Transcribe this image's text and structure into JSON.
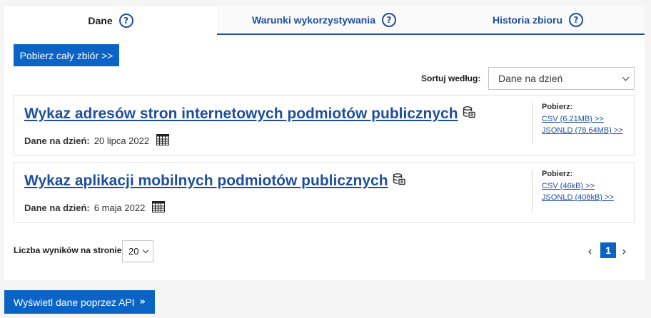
{
  "tabs": [
    {
      "label": "Dane",
      "help": "?"
    },
    {
      "label": "Warunki wykorzystywania",
      "help": "?"
    },
    {
      "label": "Historia zbioru",
      "help": "?"
    }
  ],
  "download_all_label": "Pobierz cały zbiór >>",
  "sort": {
    "label": "Sortuj według:",
    "value": "Dane na dzień"
  },
  "resources": [
    {
      "title": "Wykaz adresów stron internetowych podmiotów publicznych",
      "date_label": "Dane na dzień:",
      "date_value": "20 lipca 2022",
      "download_label": "Pobierz:",
      "links": [
        "CSV (6.21MB) >>",
        "JSONLD (78.64MB) >>"
      ]
    },
    {
      "title": "Wykaz aplikacji mobilnych podmiotów publicznych",
      "date_label": "Dane na dzień:",
      "date_value": "6 maja 2022",
      "download_label": "Pobierz:",
      "links": [
        "CSV (46kB) >>",
        "JSONLD (408kB) >>"
      ]
    }
  ],
  "per_page": {
    "label": "Liczba wyników na stronie:",
    "value": "20"
  },
  "pagination": {
    "prev": "‹",
    "current": "1",
    "next": "›"
  },
  "api_button_label": "Wyświetl dane poprzez API",
  "api_button_icon": "»",
  "colors": {
    "primary": "#0a63c5",
    "link": "#1f4f9b"
  }
}
